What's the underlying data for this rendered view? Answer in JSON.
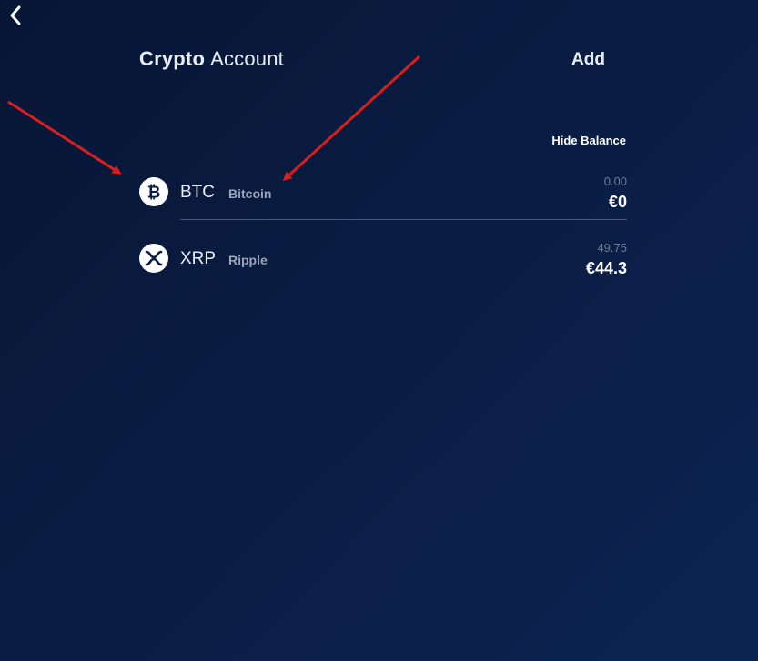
{
  "header": {
    "title_bold": "Crypto",
    "title_light": "Account",
    "add_label": "Add"
  },
  "hide_balance_label": "Hide Balance",
  "accounts": [
    {
      "ticker": "BTC",
      "name": "Bitcoin",
      "amount": "0.00",
      "fiat": "€0",
      "icon": "bitcoin-icon"
    },
    {
      "ticker": "XRP",
      "name": "Ripple",
      "amount": "49.75",
      "fiat": "€44.3",
      "icon": "ripple-icon"
    }
  ],
  "colors": {
    "background_start": "#071636",
    "background_end": "#0c2452",
    "annotation_arrow": "#d81e1e",
    "muted_text": "#9aa4b6"
  }
}
